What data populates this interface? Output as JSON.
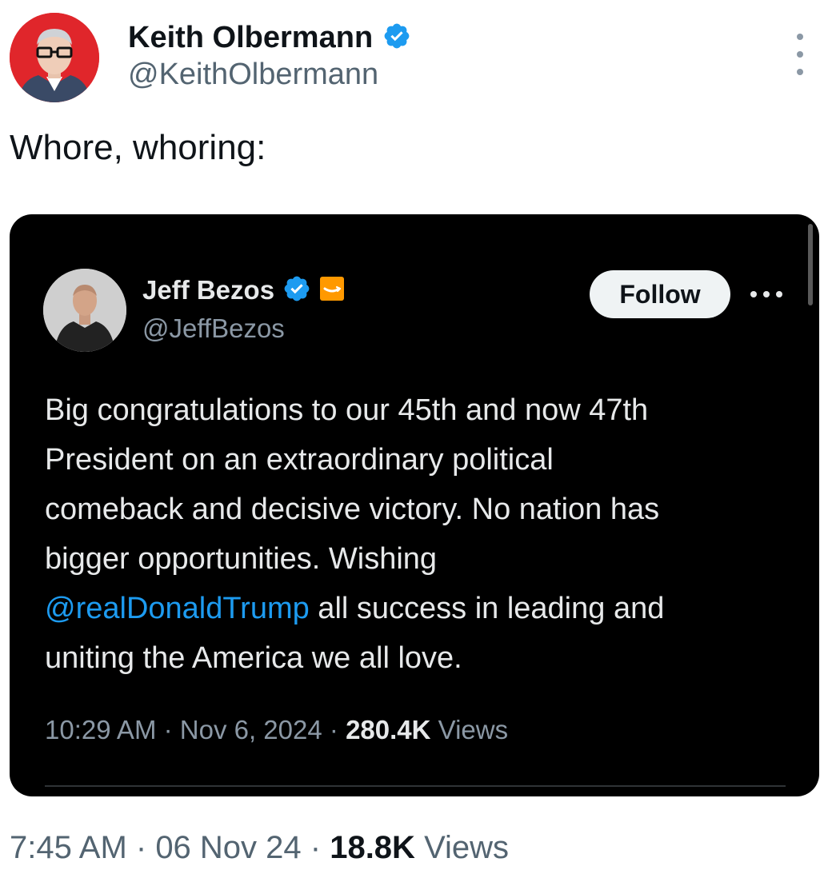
{
  "author": {
    "name": "Keith Olbermann",
    "handle": "@KeithOlbermann",
    "avatar_icon": "person-avatar",
    "avatar_bg": "#e0262b",
    "verified_icon": "verified-badge-icon"
  },
  "tweet_text": "Whore, whoring:",
  "quoted": {
    "name": "Jeff Bezos",
    "handle": "@JeffBezos",
    "verified_icon": "verified-badge-icon",
    "affiliate_icon": "amazon-affiliate-icon",
    "follow_label": "Follow",
    "body_lines": [
      "Big congratulations to our 45th and now 47th",
      "President on an extraordinary political",
      "comeback and decisive victory. No nation has",
      "bigger opportunities. Wishing"
    ],
    "mention": "@realDonaldTrump",
    "body_after_mention": " all success in leading and",
    "body_last_line": "uniting the America we all love.",
    "time": "10:29 AM",
    "date": "Nov 6, 2024",
    "view_count": "280.4K",
    "views_label": "Views"
  },
  "meta": {
    "time": "7:45 AM",
    "date": "06 Nov 24",
    "view_count": "18.8K",
    "views_label": "Views"
  },
  "colors": {
    "accent": "#1d9bf0",
    "quote_bg": "#000000",
    "muted": "#536471"
  }
}
